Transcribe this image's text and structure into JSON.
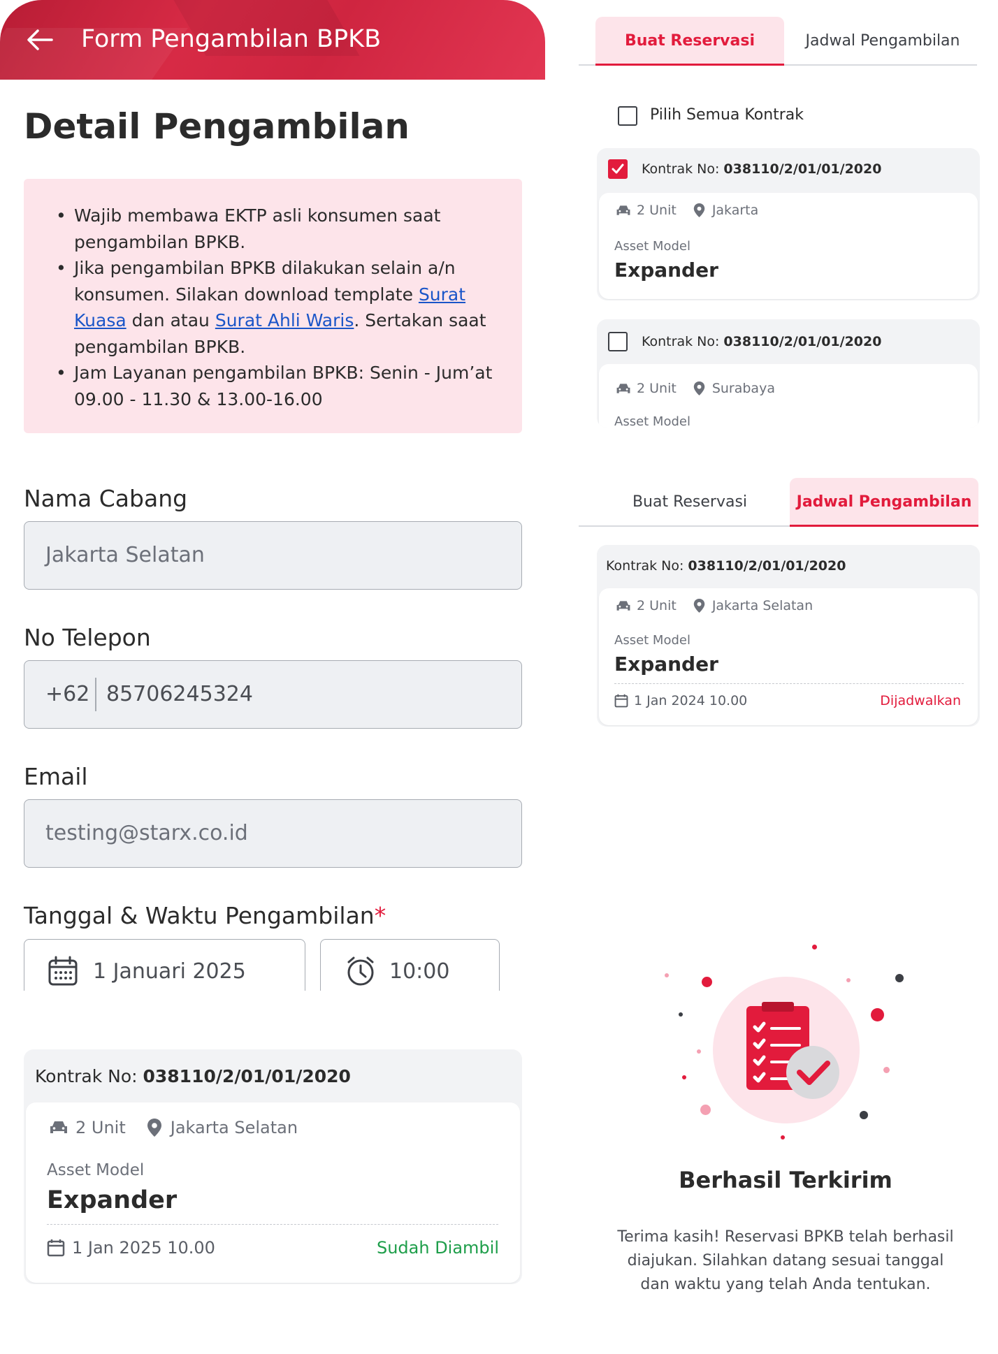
{
  "header": {
    "title": "Form Pengambilan BPKB"
  },
  "page_title": "Detail Pengambilan",
  "info": {
    "item1": "Wajib membawa EKTP asli konsumen saat pengambilan BPKB.",
    "item2_a": "Jika pengambilan BPKB dilakukan selain a/n konsumen. Silakan download template ",
    "item2_link1": "Surat Kuasa",
    "item2_b": " dan atau ",
    "item2_link2": "Surat Ahli Waris",
    "item2_c": ". Sertakan saat pengambilan BPKB.",
    "item3": "Jam Layanan pengambilan BPKB: Senin - Jum’at 09.00 - 11.30 & 13.00-16.00"
  },
  "form": {
    "branch_label": "Nama Cabang",
    "branch_value": "Jakarta Selatan",
    "phone_label": "No Telepon",
    "phone_prefix": "+62",
    "phone_value": "85706245324",
    "email_label": "Email",
    "email_value": "testing@starx.co.id",
    "datetime_label": "Tanggal & Waktu Pengambilan",
    "required_mark": "*",
    "date_value": "1 Januari 2025",
    "time_value": "10:00"
  },
  "left_card": {
    "contract_label": "Kontrak No: ",
    "contract_no": "038110/2/01/01/2020",
    "units": "2 Unit",
    "location": "Jakarta Selatan",
    "asset_label": "Asset Model",
    "asset_name": "Expander",
    "date": "1 Jan 2025 10.00",
    "status": "Sudah Diambil",
    "status_color": "#1e9e4a"
  },
  "tabs_top": {
    "tab1": "Buat Reservasi",
    "tab2": "Jadwal Pengambilan",
    "active": "tab1"
  },
  "select_all": "Pilih Semua Kontrak",
  "reservasi_cards": [
    {
      "contract_label": "Kontrak No: ",
      "contract_no": "038110/2/01/01/2020",
      "checked": true,
      "units": "2 Unit",
      "location": "Jakarta",
      "asset_label": "Asset Model",
      "asset_name": "Expander"
    },
    {
      "contract_label": "Kontrak No: ",
      "contract_no": "038110/2/01/01/2020",
      "checked": false,
      "units": "2 Unit",
      "location": "Surabaya",
      "asset_label": "Asset Model"
    }
  ],
  "tabs_bottom": {
    "tab1": "Buat Reservasi",
    "tab2": "Jadwal Pengambilan",
    "active": "tab2"
  },
  "jadwal_card": {
    "contract_label": "Kontrak No: ",
    "contract_no": "038110/2/01/01/2020",
    "units": "2 Unit",
    "location": "Jakarta Selatan",
    "asset_label": "Asset Model",
    "asset_name": "Expander",
    "date": "1 Jan 2024 10.00",
    "status": "Dijadwalkan",
    "status_color": "#e21b3c"
  },
  "success": {
    "title": "Berhasil Terkirim",
    "text": "Terima kasih! Reservasi BPKB telah berhasil diajukan. Silahkan datang sesuai tanggal dan waktu yang telah Anda tentukan."
  },
  "colors": {
    "brand": "#d72a45",
    "accent": "#e21b3c",
    "success": "#1e9e4a",
    "info_bg": "#fde4ea"
  },
  "icons": [
    "back-arrow-icon",
    "calendar-icon",
    "clock-icon",
    "car-icon",
    "location-pin-icon",
    "checkbox-icon",
    "checklist-illustration"
  ]
}
